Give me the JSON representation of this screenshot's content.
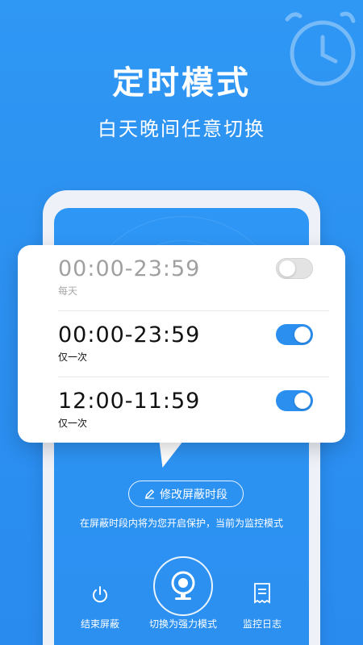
{
  "banner": {
    "title": "定时模式",
    "subtitle": "白天晚间任意切换"
  },
  "schedules": [
    {
      "time": "00:00-23:59",
      "repeat": "每天",
      "enabled": false
    },
    {
      "time": "00:00-23:59",
      "repeat": "仅一次",
      "enabled": true
    },
    {
      "time": "12:00-11:59",
      "repeat": "仅一次",
      "enabled": true
    }
  ],
  "edit_button": {
    "label": "修改屏蔽时段",
    "icon": "pencil-icon"
  },
  "status_text": "在屏蔽时段内将为您开启保护，当前为监控模式",
  "actions": {
    "end_block": {
      "label": "结束屏蔽",
      "icon": "power-icon"
    },
    "switch_strong": {
      "label": "切换为强力模式",
      "icon": "camera-icon"
    },
    "monitor_log": {
      "label": "监控日志",
      "icon": "receipt-icon"
    }
  },
  "colors": {
    "primary": "#2b8ff0",
    "toggle_off": "#e3e3e3"
  }
}
